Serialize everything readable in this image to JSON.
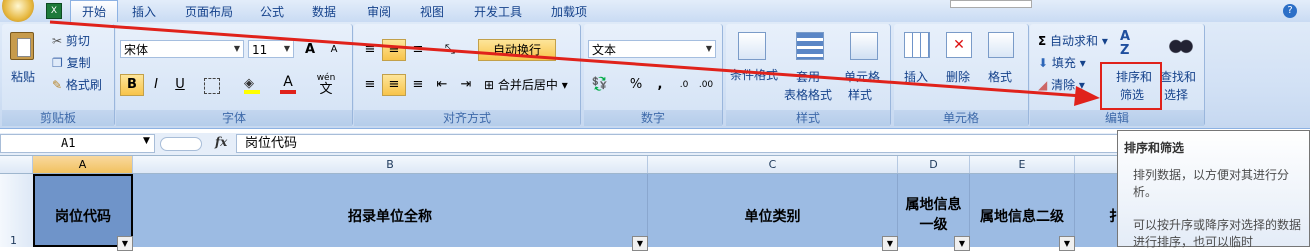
{
  "tabs": [
    {
      "label": "开始",
      "active": true
    },
    {
      "label": "插入"
    },
    {
      "label": "页面布局"
    },
    {
      "label": "公式"
    },
    {
      "label": "数据"
    },
    {
      "label": "审阅"
    },
    {
      "label": "视图"
    },
    {
      "label": "开发工具"
    },
    {
      "label": "加载项"
    }
  ],
  "clipboard": {
    "paste": "粘贴",
    "cut": "剪切",
    "copy": "复制",
    "format_painter": "格式刷",
    "label": "剪贴板"
  },
  "font": {
    "name": "宋体",
    "size": "11",
    "bold": "B",
    "italic": "I",
    "underline": "U",
    "wen": "wén",
    "wen_char": "文",
    "label": "字体",
    "grow": "A",
    "shrink": "A"
  },
  "alignment": {
    "wrap": "自动换行",
    "merge": "合并后居中",
    "label": "对齐方式"
  },
  "number": {
    "format": "文本",
    "percent": "%",
    "comma": ",",
    "label": "数字"
  },
  "styles": {
    "conditional": "条件格式",
    "table": "套用",
    "table2": "表格格式",
    "cell": "单元格",
    "cell2": "样式",
    "label": "样式"
  },
  "cells": {
    "insert": "插入",
    "delete": "删除",
    "format": "格式",
    "label": "单元格"
  },
  "editing": {
    "autosum": "自动求和",
    "fill": "填充",
    "clear": "清除",
    "sort1": "排序和",
    "sort2": "筛选",
    "find1": "查找和",
    "find2": "选择",
    "label": "编辑",
    "sigma": "Σ"
  },
  "formula_bar": {
    "name_box": "A1",
    "fx": "fx",
    "content": "岗位代码"
  },
  "columns": [
    "A",
    "B",
    "C",
    "D",
    "E"
  ],
  "headers": {
    "a": "岗位代码",
    "b": "招录单位全称",
    "c": "单位类别",
    "d1": "属地信息",
    "d2": "一级",
    "e": "属地信息二级",
    "f": "扌"
  },
  "row_number": "1",
  "tooltip": {
    "title": "排序和筛选",
    "desc": "排列数据，以方便对其进行分析。",
    "desc2": "可以按升序或降序对选择的数据进行排序，也可以临时"
  },
  "colors": {
    "accent": "#15428b",
    "highlight": "#e0221b",
    "header_fill": "#9cbbe3"
  }
}
